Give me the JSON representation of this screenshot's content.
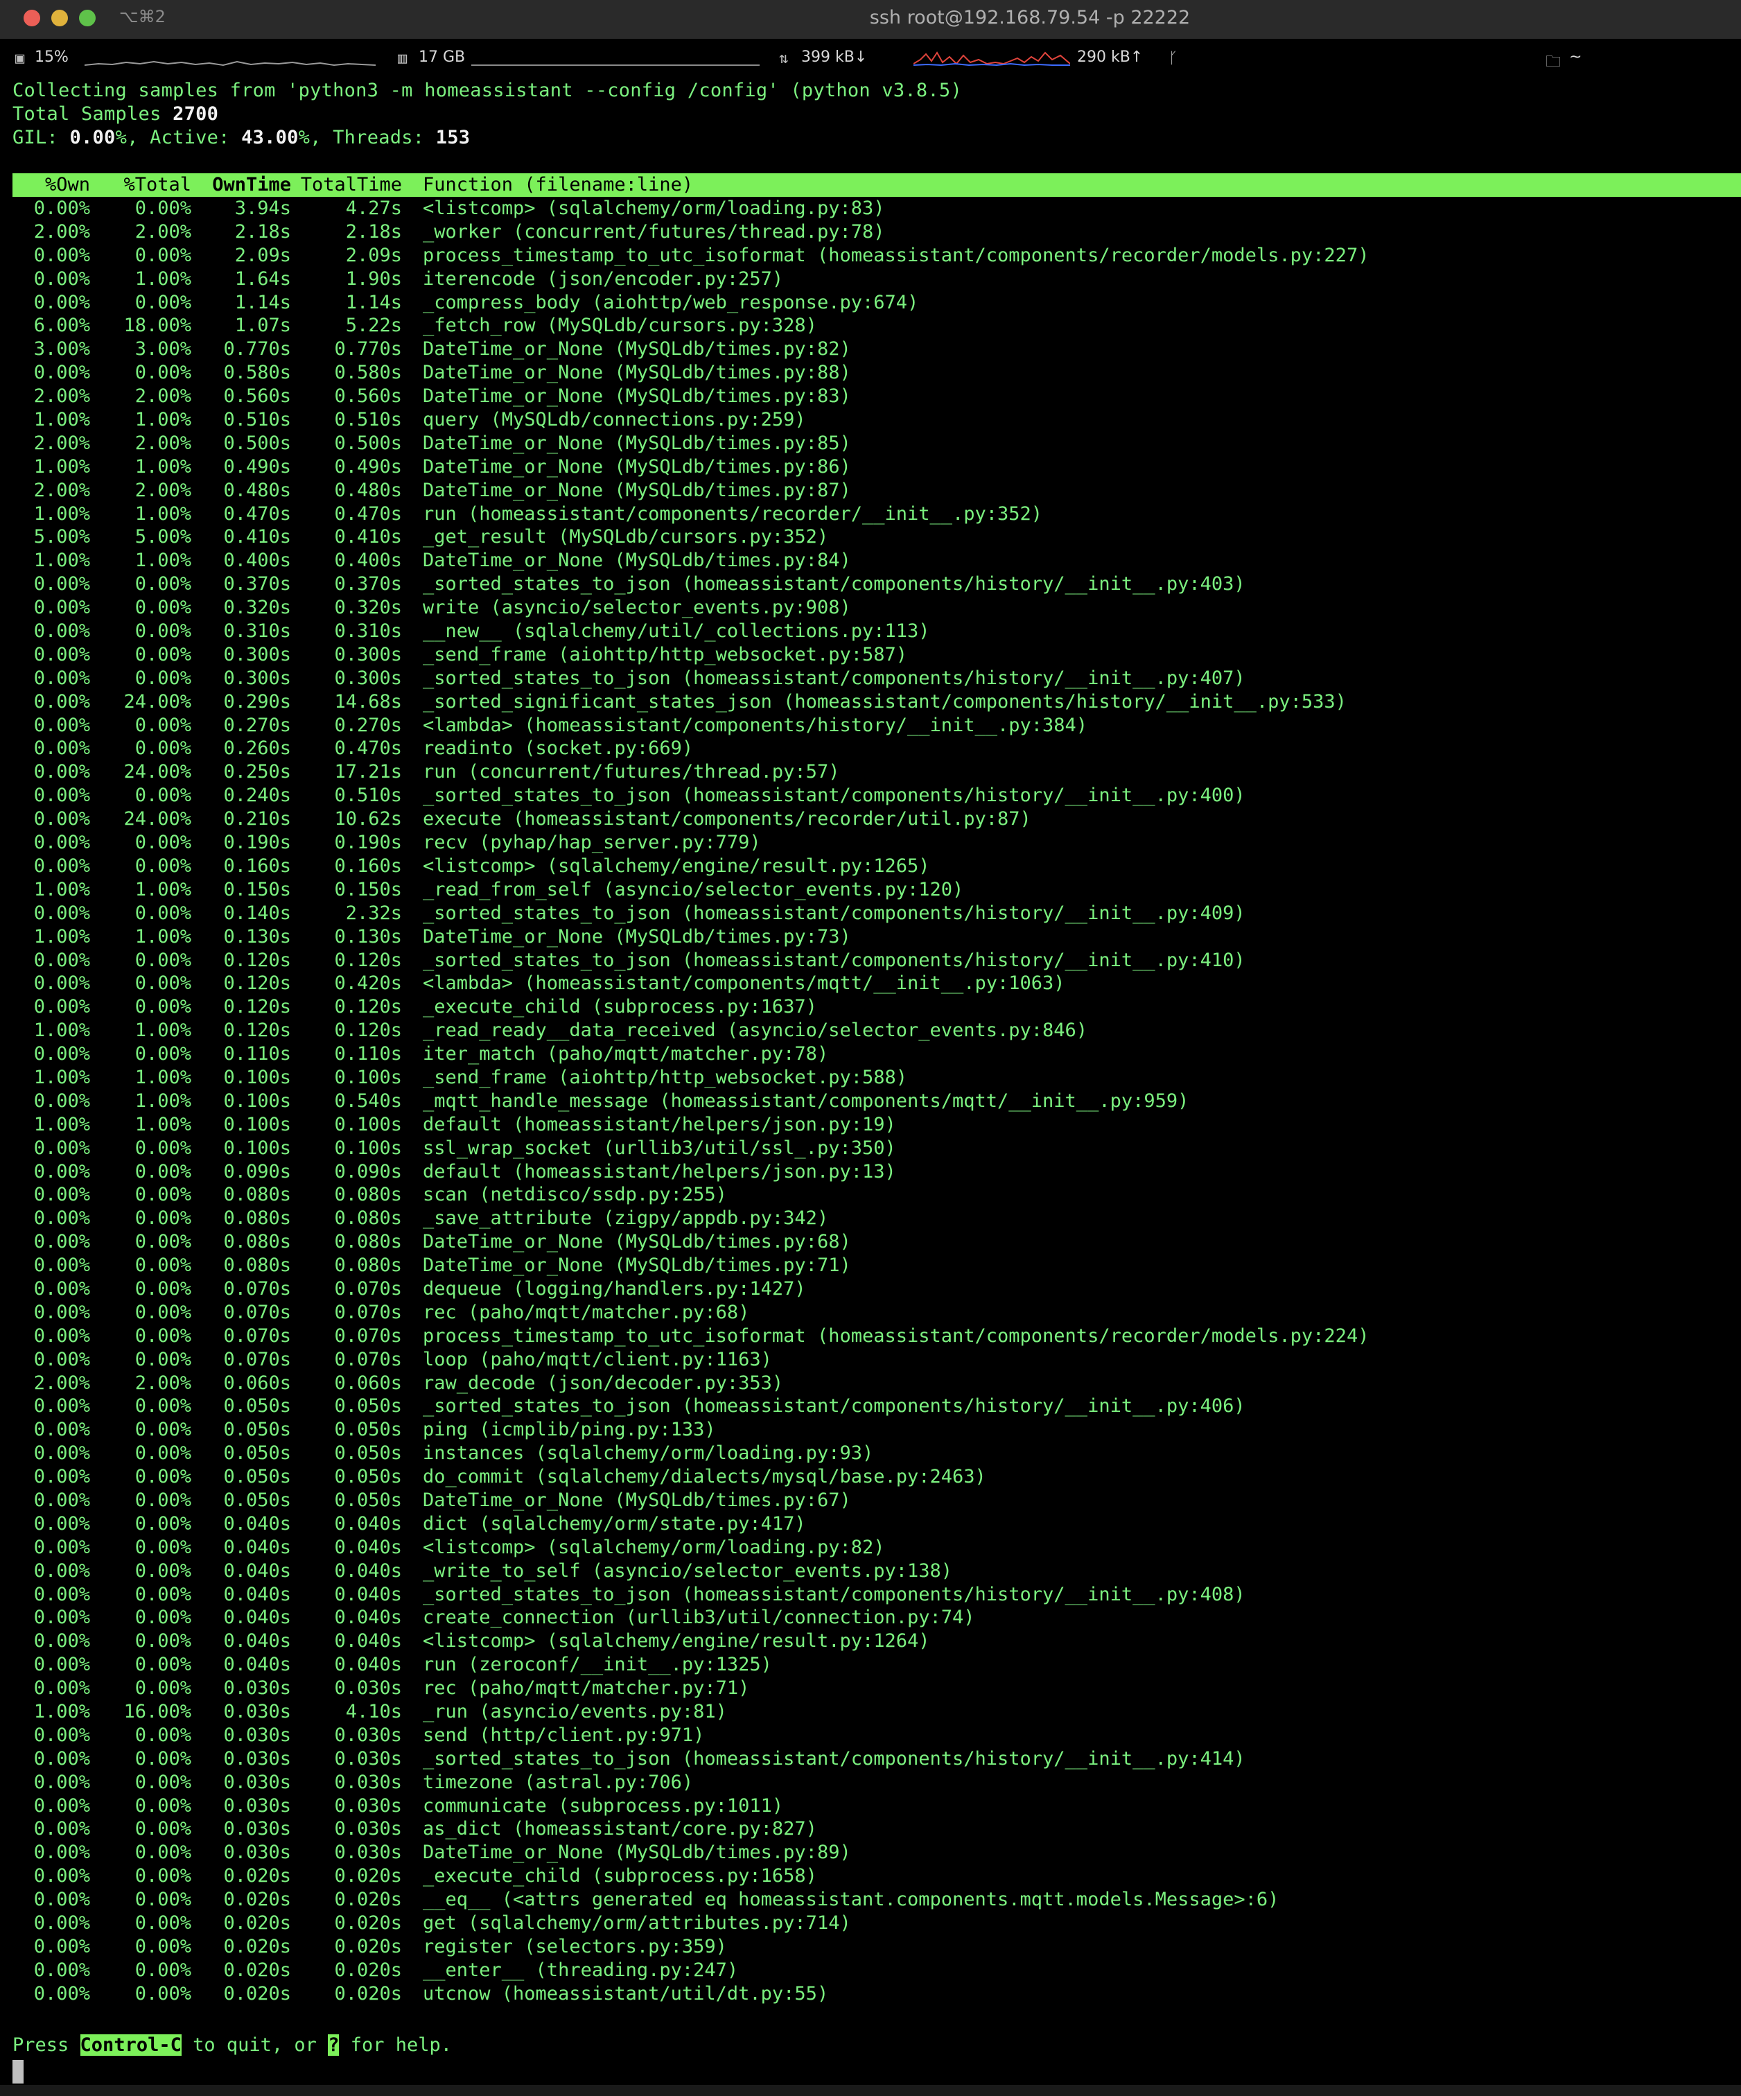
{
  "window": {
    "shortcut": "⌥⌘2",
    "title": "ssh root@192.168.79.54 -p 22222"
  },
  "statusbar": {
    "cpu": "15%",
    "mem": "17 GB",
    "net_down": "399 kB↓",
    "net_up": "290 kB↑",
    "branch_icon": "git-branch-icon",
    "dir": "~",
    "cpu_icon": "cpu-icon",
    "mem_icon": "memory-icon",
    "net_icon": "network-icon",
    "folder_icon": "folder-icon"
  },
  "info": {
    "collecting": "Collecting samples from 'python3 -m homeassistant --config /config' (python v3.8.5)",
    "total_label": "Total Samples ",
    "total_value": "2700",
    "gil_label": "GIL: ",
    "gil_value": "0.00",
    "active_label": "%, Active: ",
    "active_value": "43.00",
    "threads_label": "%, Threads: ",
    "threads_value": "153"
  },
  "table": {
    "headers": [
      "%Own",
      "%Total",
      "OwnTime",
      "TotalTime",
      "Function (filename:line)"
    ],
    "rows": [
      [
        "0.00%",
        "0.00%",
        "3.94s",
        "4.27s",
        "<listcomp> (sqlalchemy/orm/loading.py:83)"
      ],
      [
        "2.00%",
        "2.00%",
        "2.18s",
        "2.18s",
        "_worker (concurrent/futures/thread.py:78)"
      ],
      [
        "0.00%",
        "0.00%",
        "2.09s",
        "2.09s",
        "process_timestamp_to_utc_isoformat (homeassistant/components/recorder/models.py:227)"
      ],
      [
        "0.00%",
        "1.00%",
        "1.64s",
        "1.90s",
        "iterencode (json/encoder.py:257)"
      ],
      [
        "0.00%",
        "0.00%",
        "1.14s",
        "1.14s",
        "_compress_body (aiohttp/web_response.py:674)"
      ],
      [
        "6.00%",
        "18.00%",
        "1.07s",
        "5.22s",
        "_fetch_row (MySQLdb/cursors.py:328)"
      ],
      [
        "3.00%",
        "3.00%",
        "0.770s",
        "0.770s",
        "DateTime_or_None (MySQLdb/times.py:82)"
      ],
      [
        "0.00%",
        "0.00%",
        "0.580s",
        "0.580s",
        "DateTime_or_None (MySQLdb/times.py:88)"
      ],
      [
        "2.00%",
        "2.00%",
        "0.560s",
        "0.560s",
        "DateTime_or_None (MySQLdb/times.py:83)"
      ],
      [
        "1.00%",
        "1.00%",
        "0.510s",
        "0.510s",
        "query (MySQLdb/connections.py:259)"
      ],
      [
        "2.00%",
        "2.00%",
        "0.500s",
        "0.500s",
        "DateTime_or_None (MySQLdb/times.py:85)"
      ],
      [
        "1.00%",
        "1.00%",
        "0.490s",
        "0.490s",
        "DateTime_or_None (MySQLdb/times.py:86)"
      ],
      [
        "2.00%",
        "2.00%",
        "0.480s",
        "0.480s",
        "DateTime_or_None (MySQLdb/times.py:87)"
      ],
      [
        "1.00%",
        "1.00%",
        "0.470s",
        "0.470s",
        "run (homeassistant/components/recorder/__init__.py:352)"
      ],
      [
        "5.00%",
        "5.00%",
        "0.410s",
        "0.410s",
        "_get_result (MySQLdb/cursors.py:352)"
      ],
      [
        "1.00%",
        "1.00%",
        "0.400s",
        "0.400s",
        "DateTime_or_None (MySQLdb/times.py:84)"
      ],
      [
        "0.00%",
        "0.00%",
        "0.370s",
        "0.370s",
        "_sorted_states_to_json (homeassistant/components/history/__init__.py:403)"
      ],
      [
        "0.00%",
        "0.00%",
        "0.320s",
        "0.320s",
        "write (asyncio/selector_events.py:908)"
      ],
      [
        "0.00%",
        "0.00%",
        "0.310s",
        "0.310s",
        "__new__ (sqlalchemy/util/_collections.py:113)"
      ],
      [
        "0.00%",
        "0.00%",
        "0.300s",
        "0.300s",
        "_send_frame (aiohttp/http_websocket.py:587)"
      ],
      [
        "0.00%",
        "0.00%",
        "0.300s",
        "0.300s",
        "_sorted_states_to_json (homeassistant/components/history/__init__.py:407)"
      ],
      [
        "0.00%",
        "24.00%",
        "0.290s",
        "14.68s",
        "_sorted_significant_states_json (homeassistant/components/history/__init__.py:533)"
      ],
      [
        "0.00%",
        "0.00%",
        "0.270s",
        "0.270s",
        "<lambda> (homeassistant/components/history/__init__.py:384)"
      ],
      [
        "0.00%",
        "0.00%",
        "0.260s",
        "0.470s",
        "readinto (socket.py:669)"
      ],
      [
        "0.00%",
        "24.00%",
        "0.250s",
        "17.21s",
        "run (concurrent/futures/thread.py:57)"
      ],
      [
        "0.00%",
        "0.00%",
        "0.240s",
        "0.510s",
        "_sorted_states_to_json (homeassistant/components/history/__init__.py:400)"
      ],
      [
        "0.00%",
        "24.00%",
        "0.210s",
        "10.62s",
        "execute (homeassistant/components/recorder/util.py:87)"
      ],
      [
        "0.00%",
        "0.00%",
        "0.190s",
        "0.190s",
        "recv (pyhap/hap_server.py:779)"
      ],
      [
        "0.00%",
        "0.00%",
        "0.160s",
        "0.160s",
        "<listcomp> (sqlalchemy/engine/result.py:1265)"
      ],
      [
        "1.00%",
        "1.00%",
        "0.150s",
        "0.150s",
        "_read_from_self (asyncio/selector_events.py:120)"
      ],
      [
        "0.00%",
        "0.00%",
        "0.140s",
        "2.32s",
        "_sorted_states_to_json (homeassistant/components/history/__init__.py:409)"
      ],
      [
        "1.00%",
        "1.00%",
        "0.130s",
        "0.130s",
        "DateTime_or_None (MySQLdb/times.py:73)"
      ],
      [
        "0.00%",
        "0.00%",
        "0.120s",
        "0.120s",
        "_sorted_states_to_json (homeassistant/components/history/__init__.py:410)"
      ],
      [
        "0.00%",
        "0.00%",
        "0.120s",
        "0.420s",
        "<lambda> (homeassistant/components/mqtt/__init__.py:1063)"
      ],
      [
        "0.00%",
        "0.00%",
        "0.120s",
        "0.120s",
        "_execute_child (subprocess.py:1637)"
      ],
      [
        "1.00%",
        "1.00%",
        "0.120s",
        "0.120s",
        "_read_ready__data_received (asyncio/selector_events.py:846)"
      ],
      [
        "0.00%",
        "0.00%",
        "0.110s",
        "0.110s",
        "iter_match (paho/mqtt/matcher.py:78)"
      ],
      [
        "1.00%",
        "1.00%",
        "0.100s",
        "0.100s",
        "_send_frame (aiohttp/http_websocket.py:588)"
      ],
      [
        "0.00%",
        "1.00%",
        "0.100s",
        "0.540s",
        "_mqtt_handle_message (homeassistant/components/mqtt/__init__.py:959)"
      ],
      [
        "1.00%",
        "1.00%",
        "0.100s",
        "0.100s",
        "default (homeassistant/helpers/json.py:19)"
      ],
      [
        "0.00%",
        "0.00%",
        "0.100s",
        "0.100s",
        "ssl_wrap_socket (urllib3/util/ssl_.py:350)"
      ],
      [
        "0.00%",
        "0.00%",
        "0.090s",
        "0.090s",
        "default (homeassistant/helpers/json.py:13)"
      ],
      [
        "0.00%",
        "0.00%",
        "0.080s",
        "0.080s",
        "scan (netdisco/ssdp.py:255)"
      ],
      [
        "0.00%",
        "0.00%",
        "0.080s",
        "0.080s",
        "_save_attribute (zigpy/appdb.py:342)"
      ],
      [
        "0.00%",
        "0.00%",
        "0.080s",
        "0.080s",
        "DateTime_or_None (MySQLdb/times.py:68)"
      ],
      [
        "0.00%",
        "0.00%",
        "0.080s",
        "0.080s",
        "DateTime_or_None (MySQLdb/times.py:71)"
      ],
      [
        "0.00%",
        "0.00%",
        "0.070s",
        "0.070s",
        "dequeue (logging/handlers.py:1427)"
      ],
      [
        "0.00%",
        "0.00%",
        "0.070s",
        "0.070s",
        "rec (paho/mqtt/matcher.py:68)"
      ],
      [
        "0.00%",
        "0.00%",
        "0.070s",
        "0.070s",
        "process_timestamp_to_utc_isoformat (homeassistant/components/recorder/models.py:224)"
      ],
      [
        "0.00%",
        "0.00%",
        "0.070s",
        "0.070s",
        "loop (paho/mqtt/client.py:1163)"
      ],
      [
        "2.00%",
        "2.00%",
        "0.060s",
        "0.060s",
        "raw_decode (json/decoder.py:353)"
      ],
      [
        "0.00%",
        "0.00%",
        "0.050s",
        "0.050s",
        "_sorted_states_to_json (homeassistant/components/history/__init__.py:406)"
      ],
      [
        "0.00%",
        "0.00%",
        "0.050s",
        "0.050s",
        "ping (icmplib/ping.py:133)"
      ],
      [
        "0.00%",
        "0.00%",
        "0.050s",
        "0.050s",
        "instances (sqlalchemy/orm/loading.py:93)"
      ],
      [
        "0.00%",
        "0.00%",
        "0.050s",
        "0.050s",
        "do_commit (sqlalchemy/dialects/mysql/base.py:2463)"
      ],
      [
        "0.00%",
        "0.00%",
        "0.050s",
        "0.050s",
        "DateTime_or_None (MySQLdb/times.py:67)"
      ],
      [
        "0.00%",
        "0.00%",
        "0.040s",
        "0.040s",
        "dict (sqlalchemy/orm/state.py:417)"
      ],
      [
        "0.00%",
        "0.00%",
        "0.040s",
        "0.040s",
        "<listcomp> (sqlalchemy/orm/loading.py:82)"
      ],
      [
        "0.00%",
        "0.00%",
        "0.040s",
        "0.040s",
        "_write_to_self (asyncio/selector_events.py:138)"
      ],
      [
        "0.00%",
        "0.00%",
        "0.040s",
        "0.040s",
        "_sorted_states_to_json (homeassistant/components/history/__init__.py:408)"
      ],
      [
        "0.00%",
        "0.00%",
        "0.040s",
        "0.040s",
        "create_connection (urllib3/util/connection.py:74)"
      ],
      [
        "0.00%",
        "0.00%",
        "0.040s",
        "0.040s",
        "<listcomp> (sqlalchemy/engine/result.py:1264)"
      ],
      [
        "0.00%",
        "0.00%",
        "0.040s",
        "0.040s",
        "run (zeroconf/__init__.py:1325)"
      ],
      [
        "0.00%",
        "0.00%",
        "0.030s",
        "0.030s",
        "rec (paho/mqtt/matcher.py:71)"
      ],
      [
        "1.00%",
        "16.00%",
        "0.030s",
        "4.10s",
        "_run (asyncio/events.py:81)"
      ],
      [
        "0.00%",
        "0.00%",
        "0.030s",
        "0.030s",
        "send (http/client.py:971)"
      ],
      [
        "0.00%",
        "0.00%",
        "0.030s",
        "0.030s",
        "_sorted_states_to_json (homeassistant/components/history/__init__.py:414)"
      ],
      [
        "0.00%",
        "0.00%",
        "0.030s",
        "0.030s",
        "timezone (astral.py:706)"
      ],
      [
        "0.00%",
        "0.00%",
        "0.030s",
        "0.030s",
        "communicate (subprocess.py:1011)"
      ],
      [
        "0.00%",
        "0.00%",
        "0.030s",
        "0.030s",
        "as_dict (homeassistant/core.py:827)"
      ],
      [
        "0.00%",
        "0.00%",
        "0.030s",
        "0.030s",
        "DateTime_or_None (MySQLdb/times.py:89)"
      ],
      [
        "0.00%",
        "0.00%",
        "0.020s",
        "0.020s",
        "_execute_child (subprocess.py:1658)"
      ],
      [
        "0.00%",
        "0.00%",
        "0.020s",
        "0.020s",
        "__eq__ (<attrs generated eq homeassistant.components.mqtt.models.Message>:6)"
      ],
      [
        "0.00%",
        "0.00%",
        "0.020s",
        "0.020s",
        "get (sqlalchemy/orm/attributes.py:714)"
      ],
      [
        "0.00%",
        "0.00%",
        "0.020s",
        "0.020s",
        "register (selectors.py:359)"
      ],
      [
        "0.00%",
        "0.00%",
        "0.020s",
        "0.020s",
        "__enter__ (threading.py:247)"
      ],
      [
        "0.00%",
        "0.00%",
        "0.020s",
        "0.020s",
        "utcnow (homeassistant/util/dt.py:55)"
      ]
    ]
  },
  "footer": {
    "press": "Press ",
    "key_quit": "Control-C",
    "mid": " to quit, or ",
    "key_help": "?",
    "end": " for help."
  }
}
